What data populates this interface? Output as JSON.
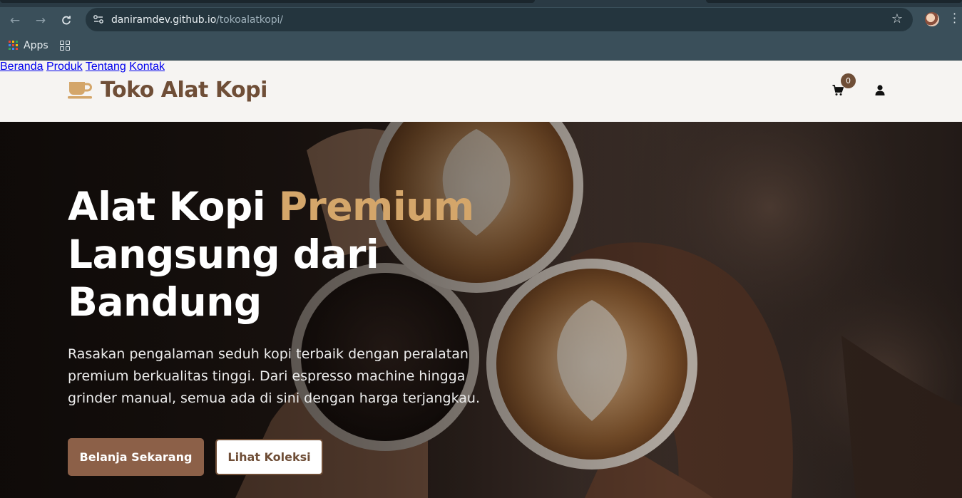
{
  "browser": {
    "url_host": "daniramdev.github.io",
    "url_path": "/tokoalatkopi/",
    "bookmarks": {
      "apps_label": "Apps"
    }
  },
  "site": {
    "logo_text": "Toko Alat Kopi",
    "nav": [
      {
        "label": "Beranda"
      },
      {
        "label": "Produk"
      },
      {
        "label": "Tentang"
      },
      {
        "label": "Kontak"
      }
    ],
    "cart_count": "0",
    "colors": {
      "brand": "#6f4e37",
      "accent": "#d4a66a",
      "button": "#8c6048",
      "logo_icon": "#d4a66a"
    }
  },
  "hero": {
    "title_part1": "Alat Kopi ",
    "title_accent": "Premium",
    "title_part2": "Langsung dari Bandung",
    "description": "Rasakan pengalaman seduh kopi terbaik dengan peralatan premium berkualitas tinggi. Dari espresso machine hingga grinder manual, semua ada di sini dengan harga terjangkau.",
    "primary_button": "Belanja Sekarang",
    "secondary_button": "Lihat Koleksi"
  },
  "icons": {
    "logo": "mug-icon",
    "cart": "shopping-cart-icon",
    "user": "user-icon"
  }
}
